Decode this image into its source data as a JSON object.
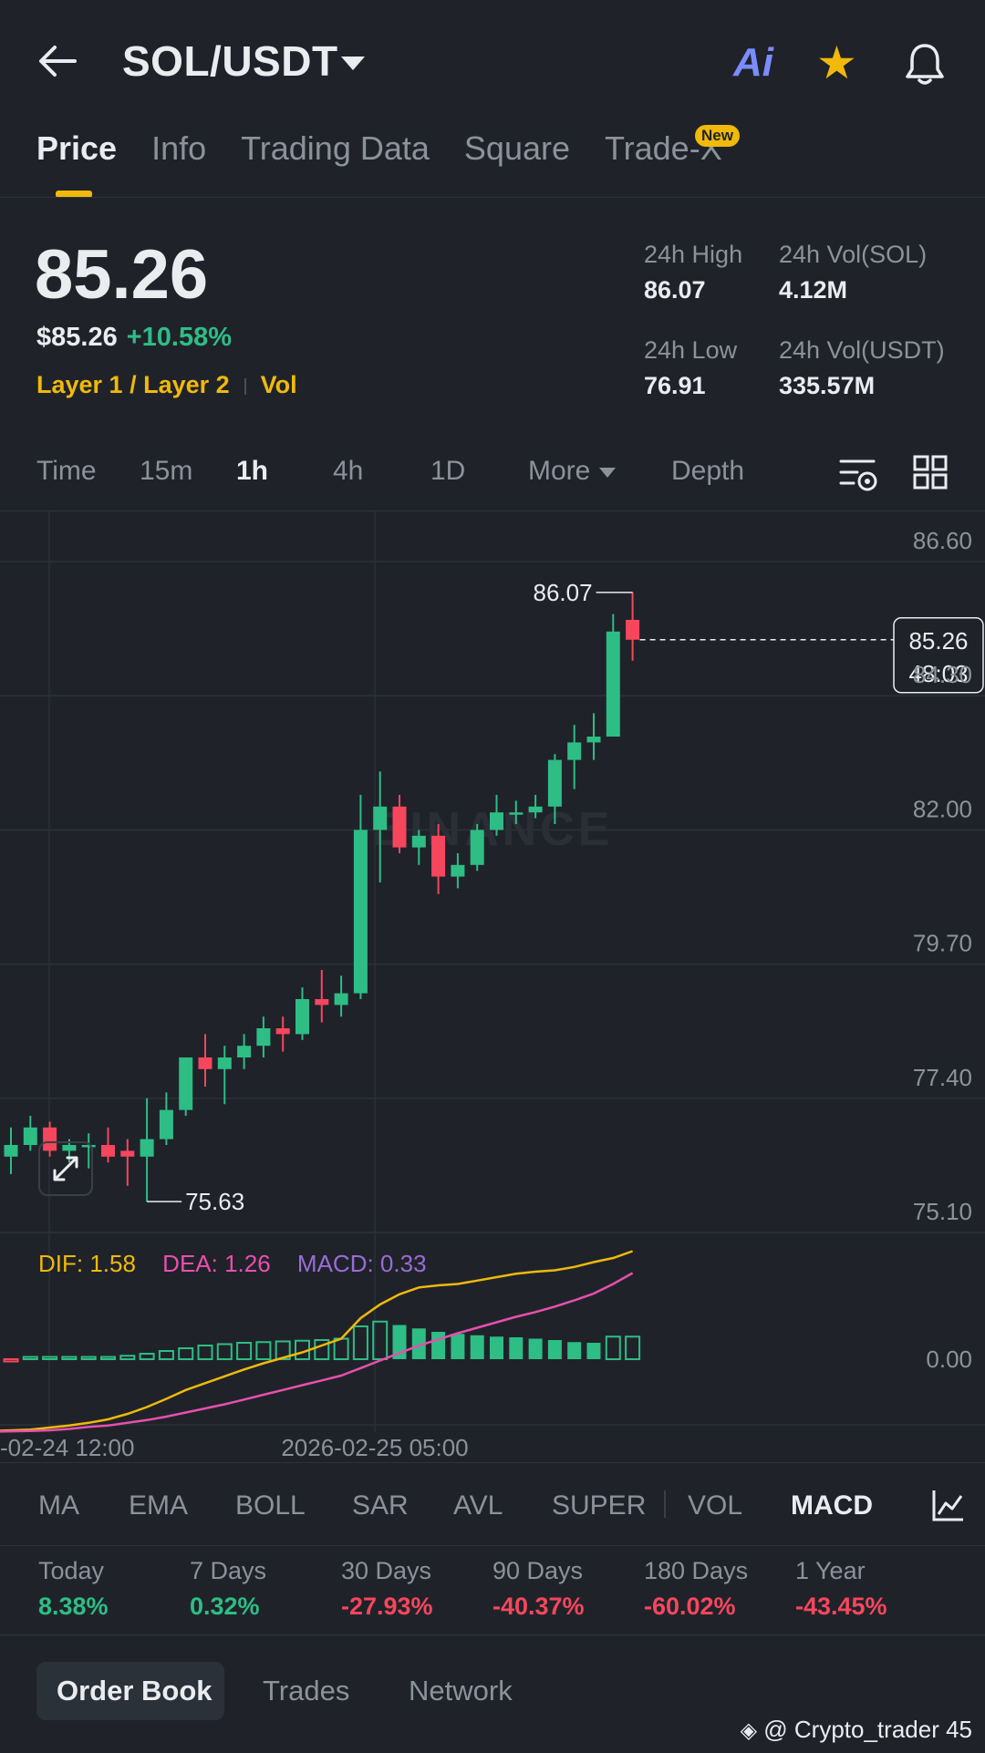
{
  "header": {
    "back_icon": "arrow-left-icon",
    "pair": "SOL/USDT",
    "ai_label": "Ai",
    "favorite_icon": "star-icon",
    "bell_icon": "bell-icon"
  },
  "tabs": [
    {
      "label": "Price",
      "active": true
    },
    {
      "label": "Info"
    },
    {
      "label": "Trading Data"
    },
    {
      "label": "Square"
    },
    {
      "label": "Trade-X",
      "badge": "New"
    }
  ],
  "price": {
    "last": "85.26",
    "usd": "$85.26",
    "change": "+10.58%",
    "tag1": "Layer 1 / Layer 2",
    "tag2": "Vol"
  },
  "stats": {
    "high_label": "24h High",
    "high": "86.07",
    "vol_sol_label": "24h Vol(SOL)",
    "vol_sol": "4.12M",
    "low_label": "24h Low",
    "low": "76.91",
    "vol_usdt_label": "24h Vol(USDT)",
    "vol_usdt": "335.57M"
  },
  "intervals": {
    "time": "Time",
    "m15": "15m",
    "h1": "1h",
    "h4": "4h",
    "d1": "1D",
    "more": "More",
    "depth": "Depth",
    "active": "1h"
  },
  "chart_data": {
    "type": "candlestick",
    "watermark": "BINANCE",
    "y_ticks": [
      "86.60",
      "84.30",
      "82.00",
      "79.70",
      "77.40",
      "75.10"
    ],
    "ylim": [
      75.1,
      86.6
    ],
    "x_ticks": [
      "-02-24 12:00",
      "2026-02-25 05:00"
    ],
    "max_label": "86.07",
    "min_label": "75.63",
    "current_price": "85.26",
    "countdown": "48:03",
    "candles": [
      {
        "o": 76.4,
        "h": 76.9,
        "l": 76.1,
        "c": 76.6
      },
      {
        "o": 76.6,
        "h": 77.1,
        "l": 76.5,
        "c": 76.9
      },
      {
        "o": 76.9,
        "h": 77.0,
        "l": 76.4,
        "c": 76.5
      },
      {
        "o": 76.5,
        "h": 76.7,
        "l": 76.3,
        "c": 76.6
      },
      {
        "o": 76.6,
        "h": 76.8,
        "l": 76.2,
        "c": 76.6
      },
      {
        "o": 76.6,
        "h": 76.9,
        "l": 76.3,
        "c": 76.4
      },
      {
        "o": 76.5,
        "h": 76.7,
        "l": 75.9,
        "c": 76.4
      },
      {
        "o": 76.4,
        "h": 77.4,
        "l": 75.63,
        "c": 76.7
      },
      {
        "o": 76.7,
        "h": 77.5,
        "l": 76.6,
        "c": 77.2
      },
      {
        "o": 77.2,
        "h": 78.1,
        "l": 77.1,
        "c": 78.1
      },
      {
        "o": 78.1,
        "h": 78.5,
        "l": 77.6,
        "c": 77.9
      },
      {
        "o": 77.9,
        "h": 78.3,
        "l": 77.3,
        "c": 78.1
      },
      {
        "o": 78.1,
        "h": 78.5,
        "l": 77.9,
        "c": 78.3
      },
      {
        "o": 78.3,
        "h": 78.8,
        "l": 78.1,
        "c": 78.6
      },
      {
        "o": 78.6,
        "h": 78.8,
        "l": 78.2,
        "c": 78.5
      },
      {
        "o": 78.5,
        "h": 79.3,
        "l": 78.4,
        "c": 79.1
      },
      {
        "o": 79.1,
        "h": 79.6,
        "l": 78.7,
        "c": 79.0
      },
      {
        "o": 79.0,
        "h": 79.5,
        "l": 78.8,
        "c": 79.2
      },
      {
        "o": 79.2,
        "h": 82.6,
        "l": 79.1,
        "c": 82.0
      },
      {
        "o": 82.0,
        "h": 83.0,
        "l": 81.1,
        "c": 82.4
      },
      {
        "o": 82.4,
        "h": 82.6,
        "l": 81.6,
        "c": 81.7
      },
      {
        "o": 81.7,
        "h": 82.0,
        "l": 81.4,
        "c": 81.9
      },
      {
        "o": 81.9,
        "h": 82.1,
        "l": 80.9,
        "c": 81.2
      },
      {
        "o": 81.2,
        "h": 81.6,
        "l": 81.0,
        "c": 81.4
      },
      {
        "o": 81.4,
        "h": 82.1,
        "l": 81.3,
        "c": 82.0
      },
      {
        "o": 82.0,
        "h": 82.6,
        "l": 81.9,
        "c": 82.3
      },
      {
        "o": 82.3,
        "h": 82.5,
        "l": 82.1,
        "c": 82.3
      },
      {
        "o": 82.3,
        "h": 82.6,
        "l": 82.2,
        "c": 82.4
      },
      {
        "o": 82.4,
        "h": 83.3,
        "l": 82.1,
        "c": 83.2
      },
      {
        "o": 83.2,
        "h": 83.8,
        "l": 82.7,
        "c": 83.5
      },
      {
        "o": 83.5,
        "h": 84.0,
        "l": 83.2,
        "c": 83.6
      },
      {
        "o": 83.6,
        "h": 85.7,
        "l": 83.6,
        "c": 85.4
      },
      {
        "o": 85.6,
        "h": 86.07,
        "l": 84.9,
        "c": 85.26
      }
    ],
    "macd": {
      "dif_label": "DIF: 1.58",
      "dea_label": "DEA: 1.26",
      "macd_label": "MACD: 0.33",
      "zero_label": "0.00",
      "dif": [
        -1.05,
        -1.03,
        -1.0,
        -0.97,
        -0.93,
        -0.88,
        -0.8,
        -0.7,
        -0.58,
        -0.45,
        -0.35,
        -0.25,
        -0.15,
        -0.06,
        0.02,
        0.1,
        0.2,
        0.3,
        0.6,
        0.8,
        0.95,
        1.05,
        1.08,
        1.1,
        1.15,
        1.2,
        1.25,
        1.28,
        1.3,
        1.35,
        1.42,
        1.48,
        1.58
      ],
      "dea": [
        -1.06,
        -1.05,
        -1.04,
        -1.02,
        -0.99,
        -0.97,
        -0.93,
        -0.89,
        -0.84,
        -0.78,
        -0.72,
        -0.66,
        -0.59,
        -0.52,
        -0.45,
        -0.38,
        -0.31,
        -0.24,
        -0.13,
        -0.02,
        0.09,
        0.2,
        0.29,
        0.38,
        0.46,
        0.54,
        0.62,
        0.69,
        0.77,
        0.86,
        0.96,
        1.1,
        1.26
      ],
      "hist": [
        -0.03,
        0.0,
        0.01,
        0.01,
        0.02,
        0.03,
        0.05,
        0.08,
        0.12,
        0.16,
        0.2,
        0.22,
        0.24,
        0.25,
        0.26,
        0.27,
        0.28,
        0.3,
        0.48,
        0.55,
        0.5,
        0.45,
        0.4,
        0.37,
        0.35,
        0.33,
        0.32,
        0.3,
        0.28,
        0.25,
        0.24,
        0.33,
        0.33
      ]
    }
  },
  "indicators": {
    "ma": "MA",
    "ema": "EMA",
    "boll": "BOLL",
    "sar": "SAR",
    "avl": "AVL",
    "super": "SUPER",
    "vol": "VOL",
    "macd": "MACD",
    "active": "MACD",
    "settings_icon": "chart-line-icon"
  },
  "performance": [
    {
      "label": "Today",
      "value": "8.38%",
      "positive": true
    },
    {
      "label": "7 Days",
      "value": "0.32%",
      "positive": true
    },
    {
      "label": "30 Days",
      "value": "-27.93%",
      "positive": false
    },
    {
      "label": "90 Days",
      "value": "-40.37%",
      "positive": false
    },
    {
      "label": "180 Days",
      "value": "-60.02%",
      "positive": false
    },
    {
      "label": "1 Year",
      "value": "-43.45%",
      "positive": false
    }
  ],
  "bottom_tabs": {
    "order_book": "Order Book",
    "trades": "Trades",
    "network": "Network",
    "active": "Order Book"
  },
  "watermark_user": "@ Crypto_trader 45",
  "colors": {
    "background": "#1f2329",
    "up": "#2ebd85",
    "down": "#f6465d",
    "accent": "#f0b90b",
    "dif": "#f0b90b",
    "dea": "#e84fae",
    "macd": "#9a6bd8"
  }
}
